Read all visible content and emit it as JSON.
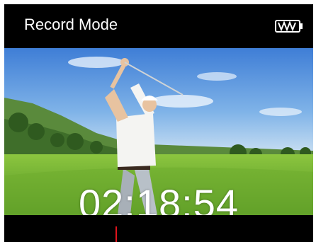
{
  "header": {
    "mode_label": "Record Mode",
    "battery_icon": "battery-full-icon"
  },
  "playback": {
    "timer": "02:18:54",
    "progress_fraction": 0.36
  },
  "colors": {
    "background": "#000000",
    "text": "#ffffff",
    "progress_marker": "#e0141c"
  }
}
